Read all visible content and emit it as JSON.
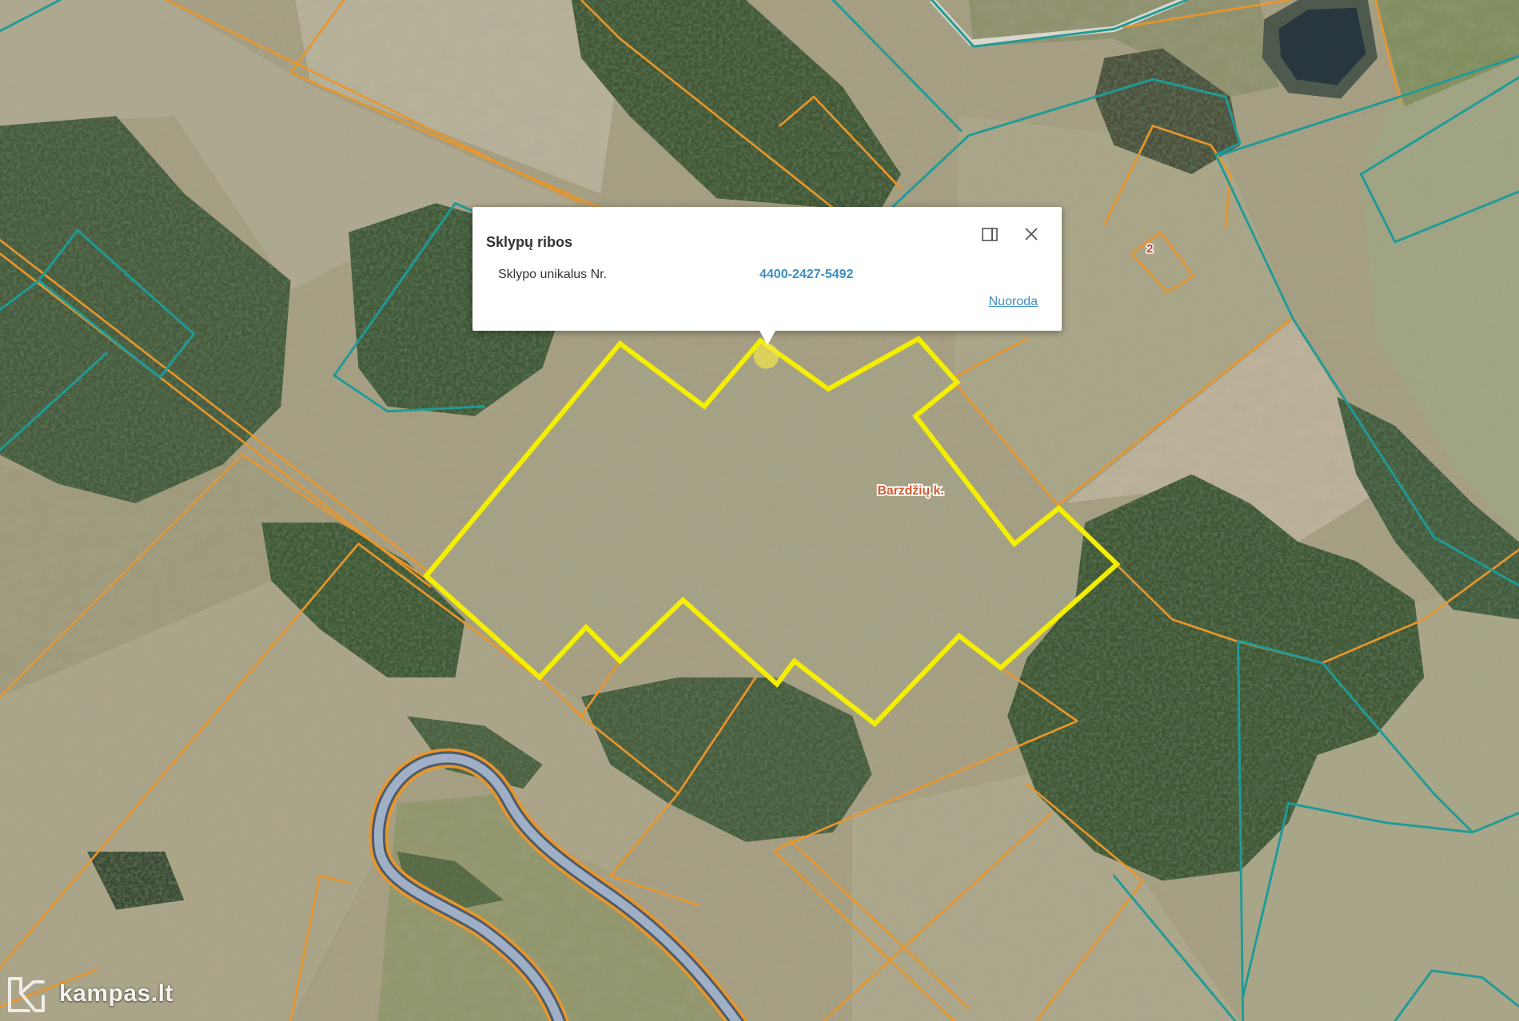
{
  "popup": {
    "title": "Sklypų ribos",
    "rows": [
      {
        "label": "Sklypo unikalus Nr.",
        "value": "4400-2427-5492"
      }
    ],
    "link_label": "Nuoroda",
    "icons": {
      "maximize": "maximize-icon",
      "close": "close-icon"
    }
  },
  "map": {
    "place_labels": [
      {
        "text": "Barzdžių k."
      }
    ],
    "parcel_markers": [
      {
        "text": "2"
      }
    ]
  },
  "watermark": {
    "text": "kampas.lt",
    "icon": "kampas-logo-icon"
  },
  "colors": {
    "selected_parcel": "#f4ee00",
    "parcel_boundary": "#e8962c",
    "cadastral_boundary": "#1f9b97",
    "link": "#3b8ec2",
    "river": "#9fb0c6",
    "place_label": "#d6572b",
    "parcel_marker": "#c0392b"
  }
}
